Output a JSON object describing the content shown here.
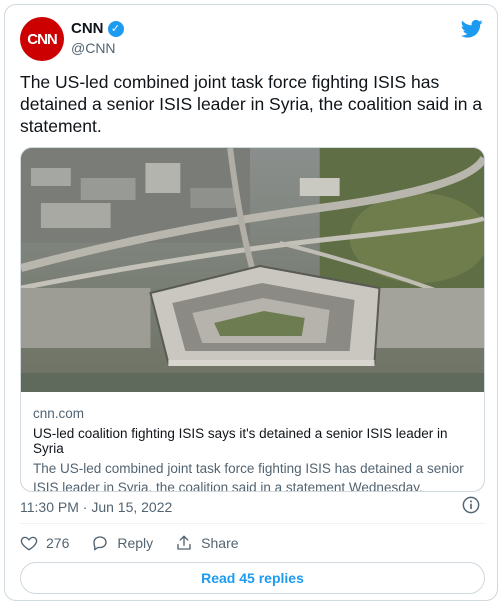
{
  "author": {
    "avatar_text": "CNN",
    "name": "CNN",
    "handle": "@CNN",
    "verified": true
  },
  "tweet": {
    "text": "The US-led combined joint task force fighting ISIS has detained a senior ISIS leader in Syria, the coalition said in a statement."
  },
  "card": {
    "image_subject": "aerial view of the Pentagon",
    "domain": "cnn.com",
    "title": "US-led coalition fighting ISIS says it's detained a senior ISIS leader in Syria",
    "description": "The US-led combined joint task force fighting ISIS has detained a senior ISIS leader in Syria, the coalition said in a statement Wednesday."
  },
  "meta": {
    "timestamp": "11:30 PM · Jun 15, 2022"
  },
  "actions": {
    "like_count": "276",
    "reply_label": "Reply",
    "share_label": "Share"
  },
  "footer": {
    "read_replies_label": "Read 45 replies"
  },
  "colors": {
    "brand_red": "#cc0000",
    "twitter_blue": "#1d9bf0",
    "secondary_text": "#536471"
  }
}
